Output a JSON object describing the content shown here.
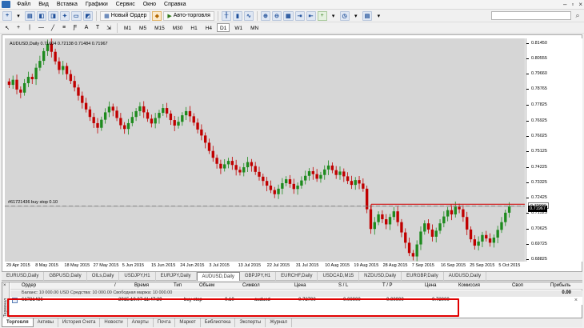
{
  "menu": [
    "Файл",
    "Вид",
    "Вставка",
    "Графики",
    "Сервис",
    "Окно",
    "Справка"
  ],
  "toolbar": {
    "new_order_label": "Новый Ордер",
    "autotrade_label": "Авто-торговля"
  },
  "timeframes": [
    "M1",
    "M5",
    "M15",
    "M30",
    "H1",
    "H4",
    "D1",
    "W1",
    "MN"
  ],
  "active_timeframe": "D1",
  "chart": {
    "title": "AUDUSD,Daily  0.71604 0.72138 0.71484 0.71967",
    "order_label": "#61721436 buy stop 0.10",
    "current_price": "0.71967",
    "order_price": "0.72000"
  },
  "chart_data": {
    "type": "candlestick",
    "symbol": "AUDUSD",
    "timeframe": "Daily",
    "last_bar": {
      "open": 0.71604,
      "high": 0.72138,
      "low": 0.71484,
      "close": 0.71967
    },
    "ylim": [
      0.6875,
      0.8176
    ],
    "y_ticks": [
      "0.81450",
      "0.80555",
      "0.79660",
      "0.78765",
      "0.77825",
      "0.76925",
      "0.76025",
      "0.75125",
      "0.74225",
      "0.73325",
      "0.72425",
      "0.71525",
      "0.70625",
      "0.69725",
      "0.68825"
    ],
    "x_ticks": [
      "29 Apr 2015",
      "8 May 2015",
      "18 May 2015",
      "27 May 2015",
      "5 Jun 2015",
      "15 Jun 2015",
      "24 Jun 2015",
      "3 Jul 2015",
      "13 Jul 2015",
      "22 Jul 2015",
      "31 Jul 2015",
      "10 Aug 2015",
      "19 Aug 2015",
      "28 Aug 2015",
      "7 Sep 2015",
      "16 Sep 2015",
      "25 Sep 2015",
      "5 Oct 2015"
    ],
    "closes": [
      0.7905,
      0.7935,
      0.7878,
      0.786,
      0.7915,
      0.7952,
      0.7938,
      0.8005,
      0.8045,
      0.8102,
      0.8145,
      0.8098,
      0.8042,
      0.7992,
      0.8015,
      0.7968,
      0.7928,
      0.789,
      0.7842,
      0.78,
      0.7762,
      0.7718,
      0.7682,
      0.7655,
      0.7702,
      0.7745,
      0.7778,
      0.7755,
      0.7712,
      0.767,
      0.7648,
      0.7682,
      0.7718,
      0.7752,
      0.778,
      0.7745,
      0.7708,
      0.768,
      0.7712,
      0.7742,
      0.777,
      0.7738,
      0.77,
      0.7668,
      0.769,
      0.7728,
      0.7752,
      0.7722,
      0.7685,
      0.7645,
      0.761,
      0.7568,
      0.752,
      0.748,
      0.7445,
      0.7418,
      0.7442,
      0.7462,
      0.7438,
      0.741,
      0.7395,
      0.7425,
      0.7455,
      0.7432,
      0.7398,
      0.737,
      0.7345,
      0.7318,
      0.7292,
      0.7268,
      0.73,
      0.7332,
      0.7355,
      0.7328,
      0.7298,
      0.7318,
      0.7348,
      0.7375,
      0.7402,
      0.7385,
      0.7358,
      0.738,
      0.7412,
      0.7435,
      0.7408,
      0.738,
      0.74,
      0.7372,
      0.7345,
      0.7322,
      0.735,
      0.733,
      0.73,
      0.718,
      0.7065,
      0.7105,
      0.715,
      0.7122,
      0.7092,
      0.7135,
      0.7168,
      0.7105,
      0.7045,
      0.6985,
      0.6925,
      0.6905,
      0.6975,
      0.705,
      0.7098,
      0.7062,
      0.702,
      0.7055,
      0.7098,
      0.7138,
      0.7175,
      0.715,
      0.7195,
      0.718,
      0.7135,
      0.7062,
      0.7005,
      0.6968,
      0.6992,
      0.703,
      0.701,
      0.6985,
      0.7015,
      0.706,
      0.7105,
      0.716,
      0.7197
    ]
  },
  "chart_tabs": [
    "EURUSD,Daily",
    "GBPUSD,Daily",
    "OILs,Daily",
    "USDJPY,H1",
    "EURJPY,Daily",
    "AUDUSD,Daily",
    "GBPJPY,H1",
    "EURCHF,Daily",
    "USDCAD,M15",
    "NZDUSD,Daily",
    "EURGBP,Daily",
    "AUDUSD,Daily"
  ],
  "active_chart_tab": 5,
  "terminal": {
    "side_label": "Терминал",
    "columns": [
      "Ордер",
      "/",
      "Время",
      "Тип",
      "Объем",
      "Символ",
      "Цена",
      "S / L",
      "T / P",
      "Цена",
      "Комиссия",
      "Своп",
      "Прибыль"
    ],
    "balance_text": "Баланс: 10 000.00 USD   Средства: 10 000.00   Свободная маржа: 10 000.00",
    "balance_value": "0.00",
    "order": {
      "id": "61721436",
      "time": "2015.10.07 11:47:29",
      "type": "buy stop",
      "volume": "0.10",
      "symbol": "audusd",
      "price": "0.72700",
      "sl": "0.00000",
      "tp": "0.00000",
      "current_price": "0.72000"
    }
  },
  "bottom_tabs": [
    "Торговля",
    "Активы",
    "История Счета",
    "Новости",
    "Алерты",
    "Почта",
    "Маркет",
    "Библиотека",
    "Эксперты",
    "Журнал"
  ],
  "active_bottom_tab": 0,
  "colors": {
    "bull": "#1e8a1e",
    "bear": "#c00000",
    "order_line": "#d01010",
    "highlight": "#e00000"
  }
}
